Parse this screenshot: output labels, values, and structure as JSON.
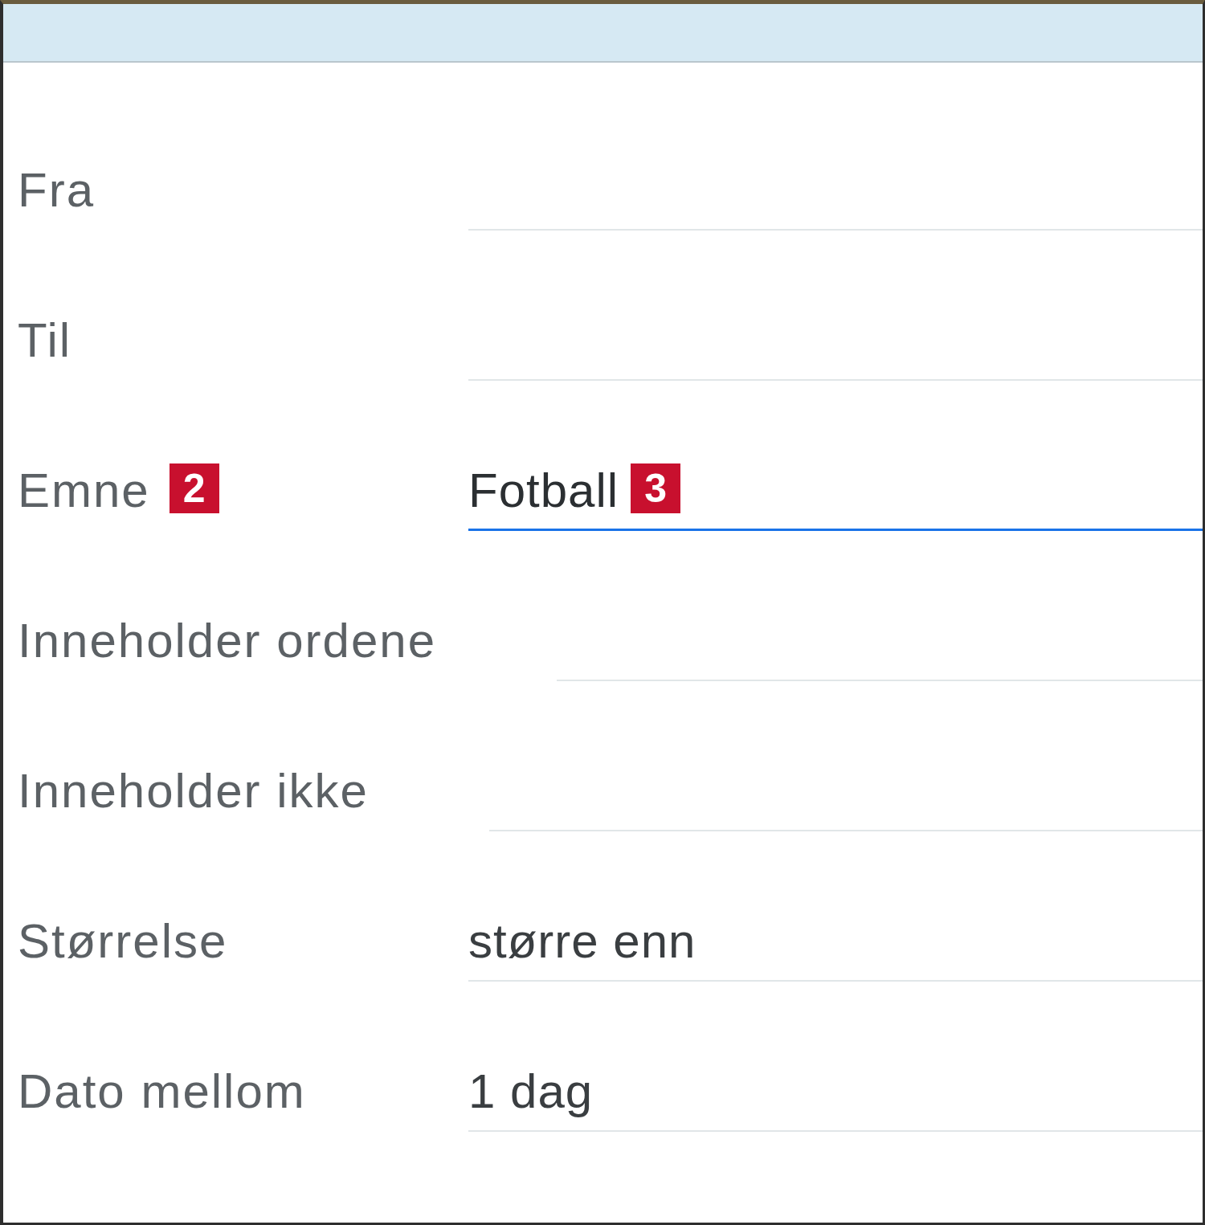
{
  "fields": [
    {
      "label": "Fra",
      "focused": false
    },
    {
      "label": "Til",
      "focused": false
    },
    {
      "label": "Emne",
      "label_badge": "2",
      "value": "Fotball",
      "value_badge": "3",
      "focused": true
    },
    {
      "label": "Inneholder ordene",
      "focused": false
    },
    {
      "label": "Inneholder ikke",
      "focused": false
    },
    {
      "label": "Størrelse",
      "value": "større enn",
      "focused": false
    },
    {
      "label": "Dato mellom",
      "value": "1 dag",
      "focused": false
    }
  ]
}
